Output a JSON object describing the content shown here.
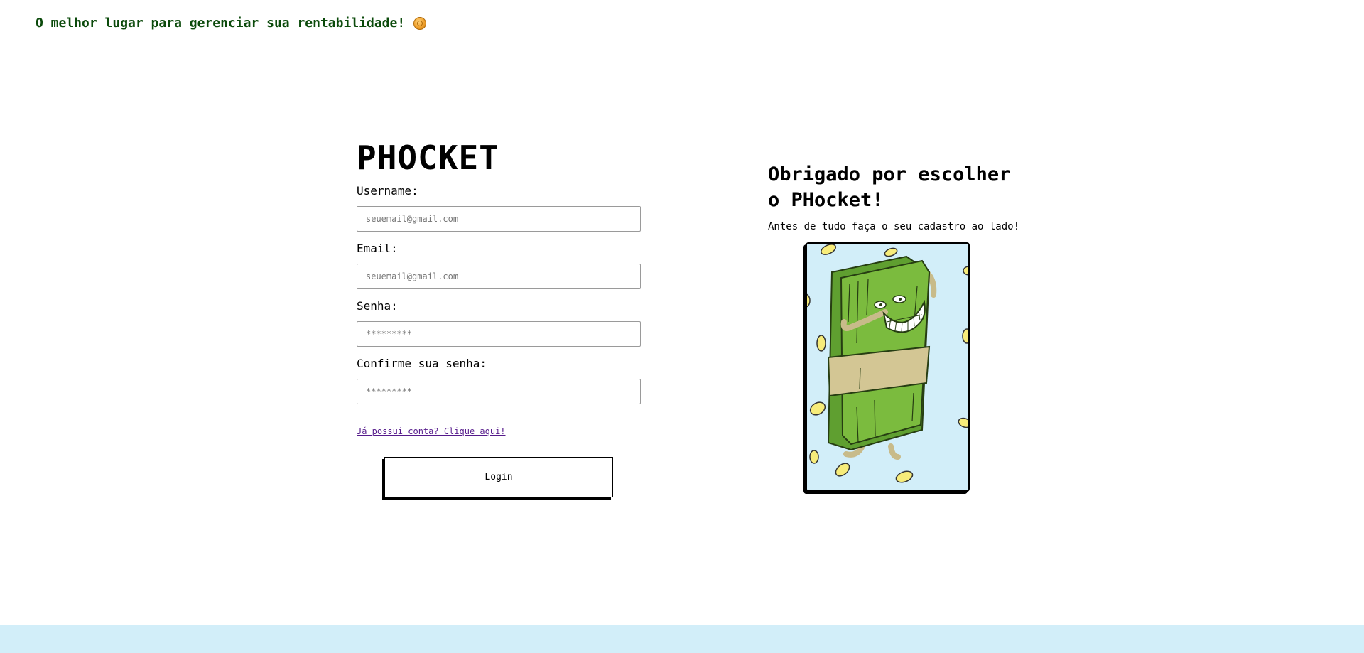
{
  "header": {
    "tagline": "O melhor lugar para gerenciar sua rentabilidade!",
    "tagline_icon": "coin-icon"
  },
  "form": {
    "brand": "PHOCKET",
    "fields": [
      {
        "label": "Username:",
        "placeholder": "seuemail@gmail.com",
        "type": "text"
      },
      {
        "label": "Email:",
        "placeholder": "seuemail@gmail.com",
        "type": "email"
      },
      {
        "label": "Senha:",
        "placeholder": "*********",
        "type": "password"
      },
      {
        "label": "Confirme sua senha:",
        "placeholder": "*********",
        "type": "password"
      }
    ],
    "login_link": "Já possui conta? Clique aqui!",
    "submit_label": "Login"
  },
  "panel": {
    "title_line1": "Obrigado por escolher",
    "title_line2": "o PHocket!",
    "subtitle": "Antes de tudo faça o seu cadastro ao lado!",
    "illustration": "money-stack-character-illustration"
  },
  "colors": {
    "tagline": "#0b4a0b",
    "illustration_bg": "#d2eef9",
    "footer_band": "#d2eef9",
    "link": "#551a8b"
  }
}
